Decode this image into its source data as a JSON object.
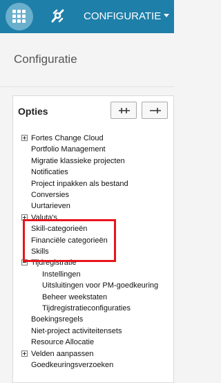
{
  "topbar": {
    "menu_label": "CONFIGURATIE",
    "grid_icon": "grid-icon",
    "logo_icon": "logo-icon",
    "accent_color": "#1e7fa9"
  },
  "page": {
    "title": "Configuratie"
  },
  "panel": {
    "title": "Opties",
    "expand_all_icon": "expand-all-icon",
    "collapse_all_icon": "collapse-all-icon"
  },
  "tree": [
    {
      "label": "Fortes Change Cloud",
      "toggle": "plus"
    },
    {
      "label": "Portfolio Management"
    },
    {
      "label": "Migratie klassieke projecten"
    },
    {
      "label": "Notificaties"
    },
    {
      "label": "Project inpakken als bestand"
    },
    {
      "label": "Conversies"
    },
    {
      "label": "Uurtarieven"
    },
    {
      "label": "Valuta's",
      "toggle": "plus"
    },
    {
      "label": "Skill-categorieën"
    },
    {
      "label": "Financiële categorieën"
    },
    {
      "label": "Skills"
    },
    {
      "label": "Tijdregistratie",
      "toggle": "minus"
    },
    {
      "label": "Instellingen",
      "level": 1
    },
    {
      "label": "Uitsluitingen voor PM-goedkeuring",
      "level": 1
    },
    {
      "label": "Beheer weekstaten",
      "level": 1
    },
    {
      "label": "Tijdregistratieconfiguraties",
      "level": 1
    },
    {
      "label": "Boekingsregels"
    },
    {
      "label": "Niet-project activiteitensets"
    },
    {
      "label": "Resource Allocatie"
    },
    {
      "label": "Velden aanpassen",
      "toggle": "plus"
    },
    {
      "label": "Goedkeuringsverzoeken"
    }
  ],
  "highlight_color": "#e8141c"
}
